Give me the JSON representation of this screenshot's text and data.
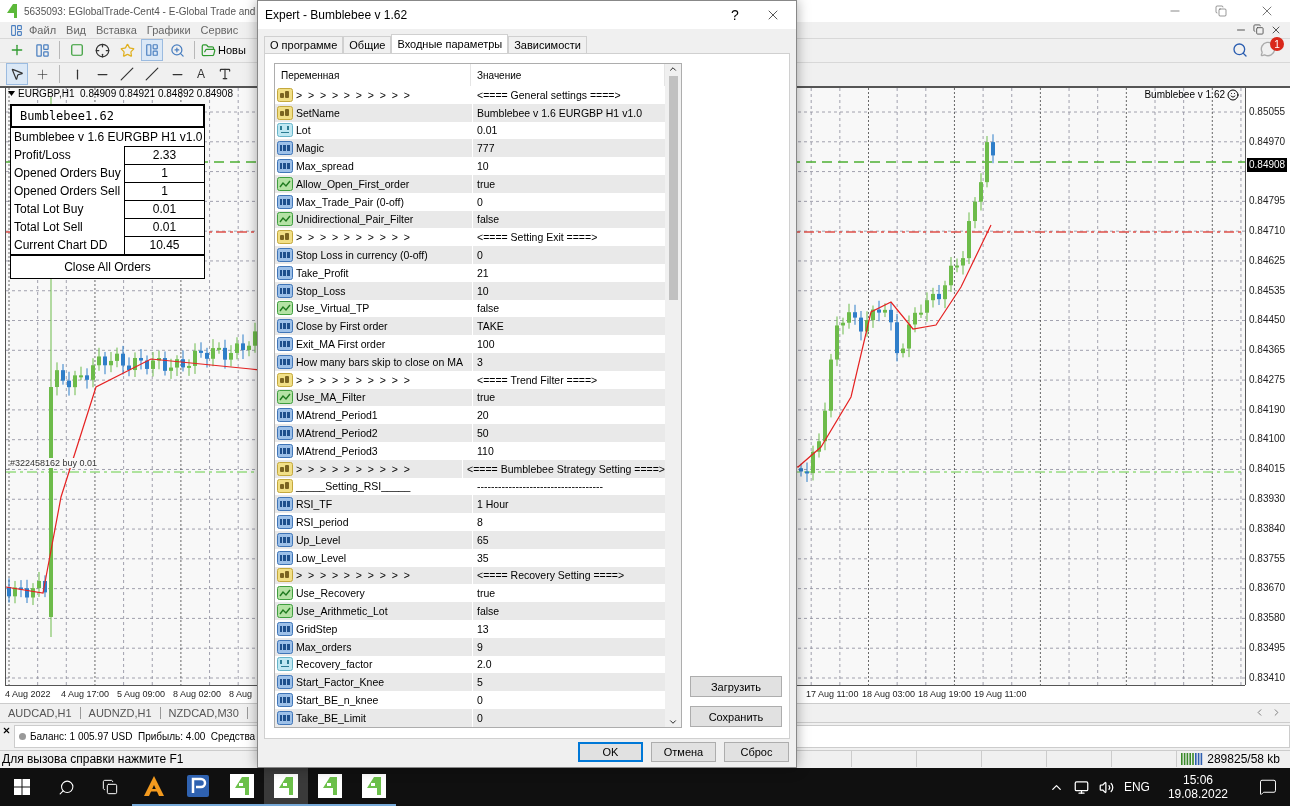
{
  "app_window": {
    "title": "5635093: EGlobalTrade-Cent4 - E-Global Trade and"
  },
  "menu": [
    "Файл",
    "Вид",
    "Вставка",
    "Графики",
    "Сервис"
  ],
  "toolbar": {
    "new_order_label": "Новы",
    "text_tool_label": "A"
  },
  "notifications": {
    "count": "1"
  },
  "chart": {
    "header": "EURGBP,H1  0.84909 0.84921 0.84892 0.84908",
    "expert_label": "Bumblebee v 1.62",
    "order_label": "#322458162 buy 0.01",
    "price_axis": [
      {
        "kind": "tick",
        "label": "0.85055"
      },
      {
        "kind": "tick",
        "label": "0.84970"
      },
      {
        "kind": "current",
        "label": "0.84908"
      },
      {
        "kind": "tick",
        "label": "0.84795"
      },
      {
        "kind": "tick",
        "label": "0.84710"
      },
      {
        "kind": "tick",
        "label": "0.84625"
      },
      {
        "kind": "tick",
        "label": "0.84535"
      },
      {
        "kind": "tick",
        "label": "0.84450"
      },
      {
        "kind": "tick",
        "label": "0.84365"
      },
      {
        "kind": "tick",
        "label": "0.84275"
      },
      {
        "kind": "tick",
        "label": "0.84190"
      },
      {
        "kind": "tick",
        "label": "0.84100"
      },
      {
        "kind": "tick",
        "label": "0.84015"
      },
      {
        "kind": "tick",
        "label": "0.83930"
      },
      {
        "kind": "tick",
        "label": "0.83840"
      },
      {
        "kind": "tick",
        "label": "0.83755"
      },
      {
        "kind": "tick",
        "label": "0.83670"
      },
      {
        "kind": "tick",
        "label": "0.83580"
      },
      {
        "kind": "tick",
        "label": "0.83495"
      },
      {
        "kind": "tick",
        "label": "0.83410"
      }
    ],
    "date_axis_left": [
      "4 Aug 2022",
      "4 Aug 17:00",
      "5 Aug 09:00",
      "8 Aug 02:00",
      "8 Aug"
    ],
    "date_axis_right": [
      "17 Aug 11:00",
      "18 Aug 03:00",
      "18 Aug 19:00",
      "19 Aug 11:00"
    ]
  },
  "ea_panel": {
    "title": "Bumblebee1.62",
    "set_name": "Bumblebee v 1.6 EURGBP H1 v1.0",
    "close_button": "Close All Orders",
    "rows": [
      {
        "label": "Profit/Loss",
        "value": "2.33"
      },
      {
        "label": "Opened Orders Buy",
        "value": "1"
      },
      {
        "label": "Opened Orders Sell",
        "value": "1"
      },
      {
        "label": "Total Lot Buy",
        "value": "0.01"
      },
      {
        "label": "Total Lot Sell",
        "value": "0.01"
      },
      {
        "label": "Current Chart DD",
        "value": "10.45"
      }
    ]
  },
  "symbol_tabs": [
    "AUDCAD,H1",
    "AUDNZD,H1",
    "NZDCAD,M30"
  ],
  "terminal": {
    "summary": "Баланс: 1 005.97 USD  Прибыль: 4.00  Средства"
  },
  "status_bar": {
    "help": "Для вызова справки нажмите F1",
    "traffic": "289825/58 kb"
  },
  "dialog": {
    "title": "Expert - Bumblebee v 1.62",
    "help_symbol": "?",
    "tabs": [
      {
        "label": "О программе",
        "selected": false
      },
      {
        "label": "Общие",
        "selected": false
      },
      {
        "label": "Входные параметры",
        "selected": true
      },
      {
        "label": "Зависимости",
        "selected": false
      }
    ],
    "columns": [
      "Переменная",
      "Значение"
    ],
    "params": [
      {
        "kind": "string",
        "name": ">  >  >  >  >  >  >  >  >  >",
        "value": "<==== General settings ====>"
      },
      {
        "kind": "string",
        "name": "SetName",
        "value": "Bumblebee v 1.6 EURGBP H1 v1.0"
      },
      {
        "kind": "double",
        "name": "Lot",
        "value": "0.01"
      },
      {
        "kind": "int",
        "name": "Magic",
        "value": "777"
      },
      {
        "kind": "int",
        "name": "Max_spread",
        "value": "10"
      },
      {
        "kind": "bool",
        "name": "Allow_Open_First_order",
        "value": "true"
      },
      {
        "kind": "int",
        "name": "Max_Trade_Pair (0-off)",
        "value": "0"
      },
      {
        "kind": "bool",
        "name": "Unidirectional_Pair_Filter",
        "value": "false"
      },
      {
        "kind": "string",
        "name": ">  >  >  >  >  >  >  >  >  >",
        "value": "<==== Setting Exit ====>"
      },
      {
        "kind": "int",
        "name": "Stop Loss in currency (0-off)",
        "value": "0"
      },
      {
        "kind": "int",
        "name": "Take_Profit",
        "value": "21"
      },
      {
        "kind": "int",
        "name": "Stop_Loss",
        "value": "10"
      },
      {
        "kind": "bool",
        "name": "Use_Virtual_TP",
        "value": "false"
      },
      {
        "kind": "int",
        "name": "Close by First order",
        "value": "TAKE"
      },
      {
        "kind": "int",
        "name": "Exit_MA First order",
        "value": "100"
      },
      {
        "kind": "int",
        "name": "How many bars skip to close on MA",
        "value": "3"
      },
      {
        "kind": "string",
        "name": ">  >  >  >  >  >  >  >  >  >",
        "value": "<==== Trend Filter ====>"
      },
      {
        "kind": "bool",
        "name": "Use_MA_Filter",
        "value": "true"
      },
      {
        "kind": "int",
        "name": "MAtrend_Period1",
        "value": "20"
      },
      {
        "kind": "int",
        "name": "MAtrend_Period2",
        "value": "50"
      },
      {
        "kind": "int",
        "name": "MAtrend_Period3",
        "value": "110"
      },
      {
        "kind": "string",
        "name": ">  >  >  >  >  >  >  >  >  >",
        "value": "<==== Bumblebee Strategy Setting ====>"
      },
      {
        "kind": "string",
        "name": "_____Setting_RSI_____",
        "value": "------------------------------------"
      },
      {
        "kind": "int",
        "name": "RSI_TF",
        "value": "1 Hour"
      },
      {
        "kind": "int",
        "name": "RSI_period",
        "value": "8"
      },
      {
        "kind": "int",
        "name": "Up_Level",
        "value": "65"
      },
      {
        "kind": "int",
        "name": "Low_Level",
        "value": "35"
      },
      {
        "kind": "string",
        "name": ">  >  >  >  >  >  >  >  >  >",
        "value": "<==== Recovery Setting ====>"
      },
      {
        "kind": "bool",
        "name": "Use_Recovery",
        "value": "true"
      },
      {
        "kind": "bool",
        "name": "Use_Arithmetic_Lot",
        "value": "false"
      },
      {
        "kind": "int",
        "name": "GridStep",
        "value": "13"
      },
      {
        "kind": "int",
        "name": "Max_orders",
        "value": "9"
      },
      {
        "kind": "double",
        "name": "Recovery_factor",
        "value": "2.0"
      },
      {
        "kind": "int",
        "name": "Start_Factor_Knee",
        "value": "5"
      },
      {
        "kind": "int",
        "name": "Start_BE_n_knee",
        "value": "0"
      },
      {
        "kind": "int",
        "name": "Take_BE_Limit",
        "value": "0"
      }
    ],
    "side_buttons": [
      "Загрузить",
      "Сохранить"
    ],
    "buttons": [
      {
        "label": "OK",
        "default": true
      },
      {
        "label": "Отмена",
        "default": false
      },
      {
        "label": "Сброс",
        "default": false
      }
    ]
  },
  "taskbar": {
    "apps": [
      {
        "kind": "triangle",
        "active": false
      },
      {
        "kind": "blue",
        "active": false
      },
      {
        "kind": "green",
        "active": false
      },
      {
        "kind": "green",
        "active": true
      },
      {
        "kind": "green",
        "active": false
      },
      {
        "kind": "green",
        "active": false
      }
    ],
    "language": "ENG",
    "time": "15:06",
    "date": "19.08.2022"
  }
}
